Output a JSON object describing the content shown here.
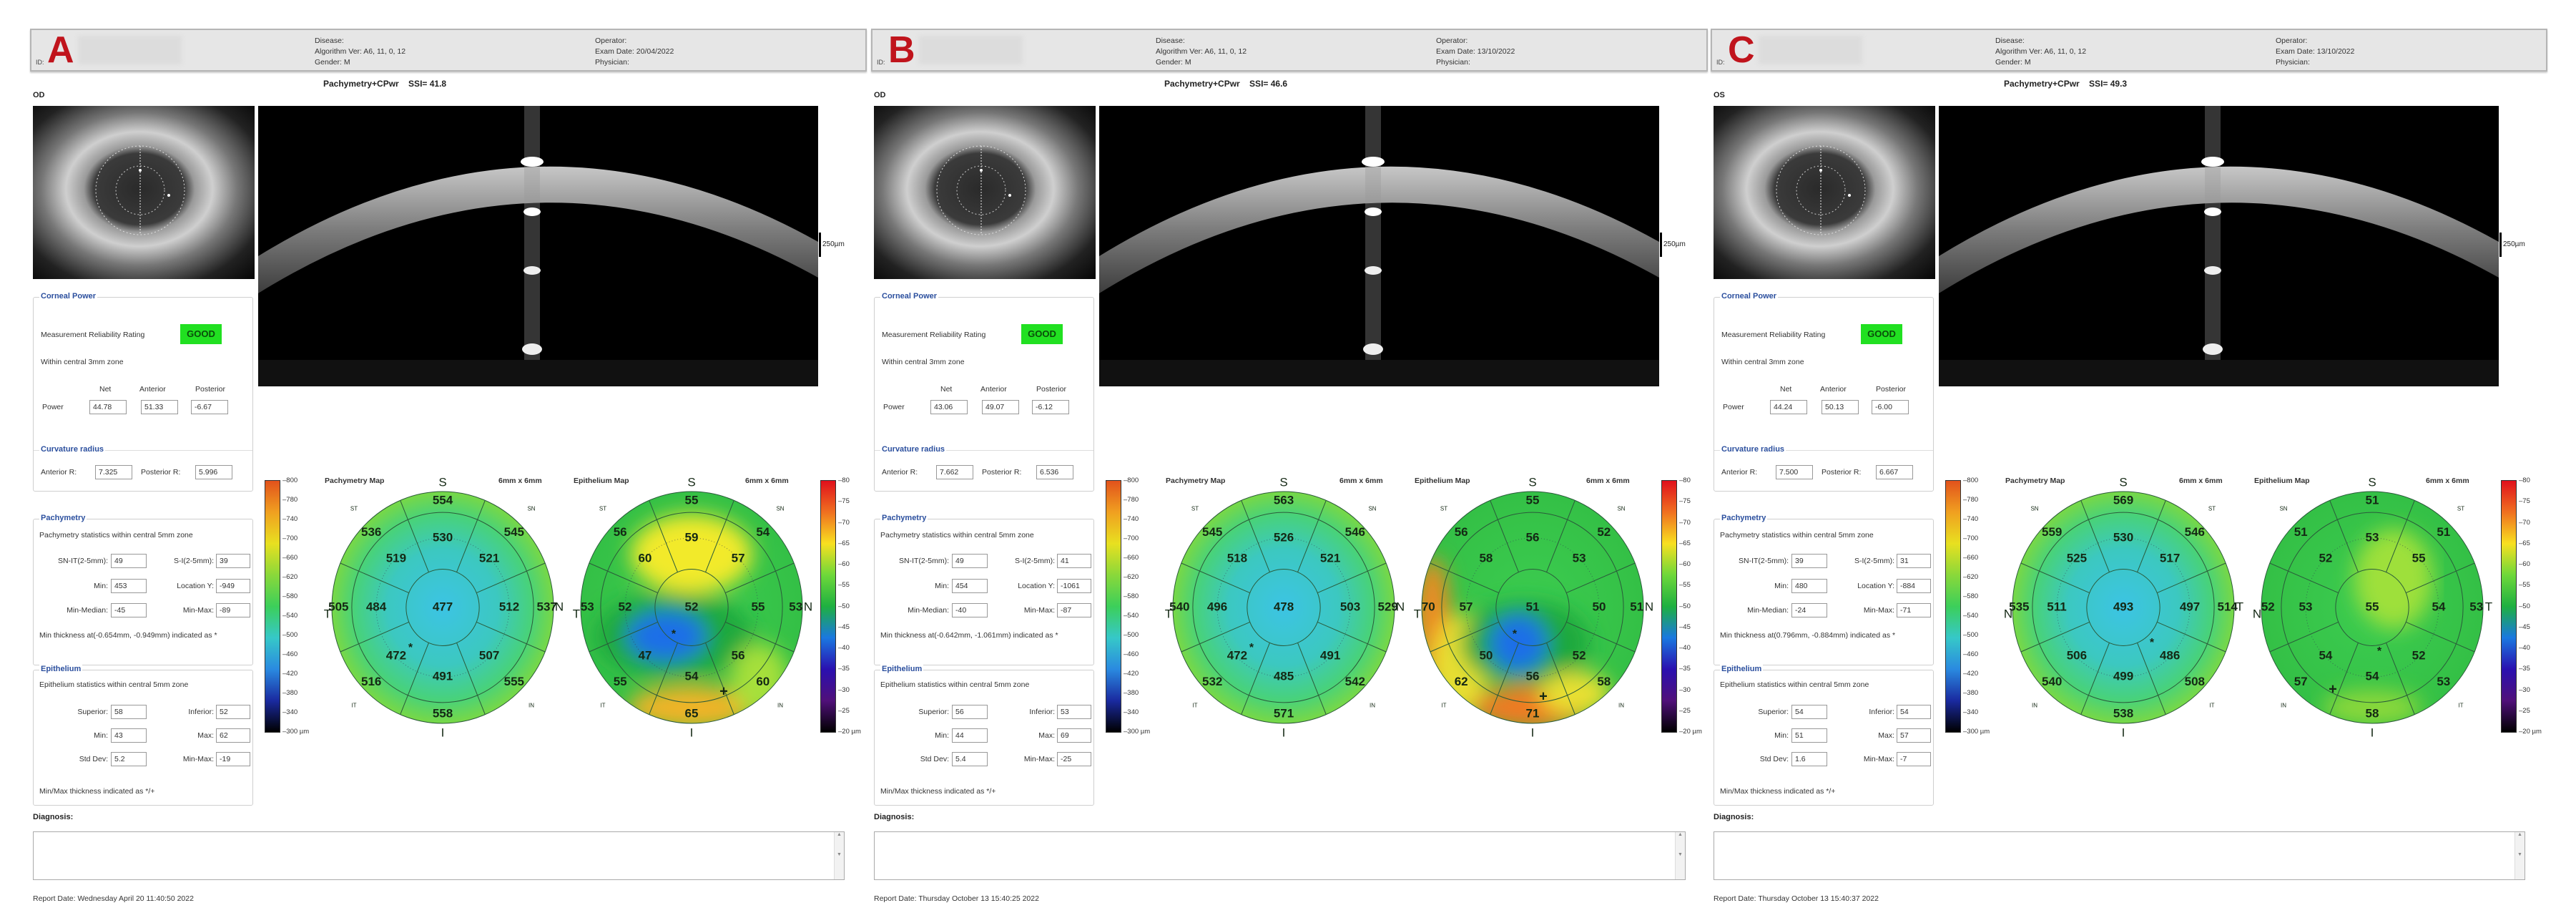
{
  "panels": [
    {
      "letter": "A",
      "id_label": "ID:",
      "header": {
        "disease": "Disease:",
        "algorithm": "Algorithm Ver: A6, 11, 0, 12",
        "gender": "Gender: M",
        "operator": "Operator:",
        "exam_date": "Exam Date: 20/04/2022",
        "physician": "Physician:"
      },
      "scan_title": "Pachymetry+CPwr    SSI= 41.8",
      "eye": "OD",
      "scale_label": "250µm",
      "corneal_power": {
        "heading": "Corneal Power",
        "rating_label": "Measurement Reliability Rating",
        "rating": "GOOD",
        "zone": "Within central 3mm zone",
        "col_net": "Net",
        "col_anterior": "Anterior",
        "col_posterior": "Posterior",
        "row_label": "Power",
        "net": "44.78",
        "anterior": "51.33",
        "posterior": "-6.67"
      },
      "curvature": {
        "heading": "Curvature radius",
        "anterior_label": "Anterior R:",
        "anterior": "7.325",
        "posterior_label": "Posterior R:",
        "posterior": "5.996"
      },
      "pachymetry": {
        "heading": "Pachymetry",
        "subtitle": "Pachymetry statistics within central 5mm zone",
        "snit_label": "SN-IT(2-5mm):",
        "snit": "49",
        "si_label": "S-I(2-5mm):",
        "si": "39",
        "min_label": "Min:",
        "min": "453",
        "locy_label": "Location Y:",
        "locy": "-949",
        "minmed_label": "Min-Median:",
        "minmed": "-45",
        "minmax_label": "Min-Max:",
        "minmax": "-89",
        "note": "Min thickness at(-0.654mm, -0.949mm) indicated as *"
      },
      "epithelium": {
        "heading": "Epithelium",
        "subtitle": "Epithelium statistics within central 5mm zone",
        "sup_label": "Superior:",
        "sup": "58",
        "inf_label": "Inferior:",
        "inf": "52",
        "min_label": "Min:",
        "min": "43",
        "max_label": "Max:",
        "max": "62",
        "sd_label": "Std Dev:",
        "sd": "5.2",
        "minmax_label": "Min-Max:",
        "minmax": "-19",
        "note": "Min/Max thickness indicated as */+"
      },
      "orientation": {
        "top": "S",
        "bottom": "I",
        "left": "T",
        "right": "N",
        "top_left": "ST",
        "top_right": "SN",
        "bottom_left": "IT",
        "bottom_right": "IN"
      },
      "pachy_map": {
        "title": "Pachymetry Map",
        "size": "6mm x 6mm",
        "center": "477",
        "inner": {
          "top": "530",
          "top_left": "519",
          "top_right": "521",
          "left": "484",
          "right": "512",
          "bottom_left": "472",
          "bottom_right": "507",
          "bottom": "491"
        },
        "outer": {
          "top": "554",
          "top_left": "536",
          "top_right": "545",
          "left": "505",
          "right": "537",
          "bottom_left": "516",
          "bottom_right": "555",
          "bottom": "558"
        }
      },
      "epi_map": {
        "title": "Epithelium Map",
        "size": "6mm x 6mm",
        "center": "52",
        "inner": {
          "top": "59",
          "top_left": "60",
          "top_right": "57",
          "left": "52",
          "right": "55",
          "bottom_left": "47",
          "bottom_right": "56",
          "bottom": "54"
        },
        "outer": {
          "top": "55",
          "top_left": "56",
          "top_right": "54",
          "left": "53",
          "right": "53",
          "bottom_left": "55",
          "bottom_right": "60",
          "bottom": "65"
        }
      },
      "diagnosis_label": "Diagnosis:",
      "report_date": "Report Date: Wednesday April 20 11:40:50 2022"
    },
    {
      "letter": "B",
      "id_label": "ID:",
      "header": {
        "disease": "Disease:",
        "algorithm": "Algorithm Ver: A6, 11, 0, 12",
        "gender": "Gender: M",
        "operator": "Operator:",
        "exam_date": "Exam Date: 13/10/2022",
        "physician": "Physician:"
      },
      "scan_title": "Pachymetry+CPwr    SSI= 46.6",
      "eye": "OD",
      "scale_label": "250µm",
      "corneal_power": {
        "heading": "Corneal Power",
        "rating_label": "Measurement Reliability Rating",
        "rating": "GOOD",
        "zone": "Within central 3mm zone",
        "col_net": "Net",
        "col_anterior": "Anterior",
        "col_posterior": "Posterior",
        "row_label": "Power",
        "net": "43.06",
        "anterior": "49.07",
        "posterior": "-6.12"
      },
      "curvature": {
        "heading": "Curvature radius",
        "anterior_label": "Anterior R:",
        "anterior": "7.662",
        "posterior_label": "Posterior R:",
        "posterior": "6.536"
      },
      "pachymetry": {
        "heading": "Pachymetry",
        "subtitle": "Pachymetry statistics within central 5mm zone",
        "snit_label": "SN-IT(2-5mm):",
        "snit": "49",
        "si_label": "S-I(2-5mm):",
        "si": "41",
        "min_label": "Min:",
        "min": "454",
        "locy_label": "Location Y:",
        "locy": "-1061",
        "minmed_label": "Min-Median:",
        "minmed": "-40",
        "minmax_label": "Min-Max:",
        "minmax": "-87",
        "note": "Min thickness at(-0.642mm, -1.061mm) indicated as *"
      },
      "epithelium": {
        "heading": "Epithelium",
        "subtitle": "Epithelium statistics within central 5mm zone",
        "sup_label": "Superior:",
        "sup": "56",
        "inf_label": "Inferior:",
        "inf": "53",
        "min_label": "Min:",
        "min": "44",
        "max_label": "Max:",
        "max": "69",
        "sd_label": "Std Dev:",
        "sd": "5.4",
        "minmax_label": "Min-Max:",
        "minmax": "-25",
        "note": "Min/Max thickness indicated as */+"
      },
      "orientation": {
        "top": "S",
        "bottom": "I",
        "left": "T",
        "right": "N",
        "top_left": "ST",
        "top_right": "SN",
        "bottom_left": "IT",
        "bottom_right": "IN"
      },
      "pachy_map": {
        "title": "Pachymetry Map",
        "size": "6mm x 6mm",
        "center": "478",
        "inner": {
          "top": "526",
          "top_left": "518",
          "top_right": "521",
          "left": "496",
          "right": "503",
          "bottom_left": "472",
          "bottom_right": "491",
          "bottom": "485"
        },
        "outer": {
          "top": "563",
          "top_left": "545",
          "top_right": "546",
          "left": "540",
          "right": "529",
          "bottom_left": "532",
          "bottom_right": "542",
          "bottom": "571"
        }
      },
      "epi_map": {
        "title": "Epithelium Map",
        "size": "6mm x 6mm",
        "center": "51",
        "inner": {
          "top": "56",
          "top_left": "58",
          "top_right": "53",
          "left": "57",
          "right": "50",
          "bottom_left": "50",
          "bottom_right": "52",
          "bottom": "56"
        },
        "outer": {
          "top": "55",
          "top_left": "56",
          "top_right": "52",
          "left": "70",
          "right": "51",
          "bottom_left": "62",
          "bottom_right": "58",
          "bottom": "71"
        }
      },
      "diagnosis_label": "Diagnosis:",
      "report_date": "Report Date: Thursday October 13 15:40:25 2022"
    },
    {
      "letter": "C",
      "id_label": "ID:",
      "header": {
        "disease": "Disease:",
        "algorithm": "Algorithm Ver: A6, 11, 0, 12",
        "gender": "Gender: M",
        "operator": "Operator:",
        "exam_date": "Exam Date: 13/10/2022",
        "physician": "Physician:"
      },
      "scan_title": "Pachymetry+CPwr    SSI= 49.3",
      "eye": "OS",
      "scale_label": "250µm",
      "corneal_power": {
        "heading": "Corneal Power",
        "rating_label": "Measurement Reliability Rating",
        "rating": "GOOD",
        "zone": "Within central 3mm zone",
        "col_net": "Net",
        "col_anterior": "Anterior",
        "col_posterior": "Posterior",
        "row_label": "Power",
        "net": "44.24",
        "anterior": "50.13",
        "posterior": "-6.00"
      },
      "curvature": {
        "heading": "Curvature radius",
        "anterior_label": "Anterior R:",
        "anterior": "7.500",
        "posterior_label": "Posterior R:",
        "posterior": "6.667"
      },
      "pachymetry": {
        "heading": "Pachymetry",
        "subtitle": "Pachymetry statistics within central 5mm zone",
        "snit_label": "SN-IT(2-5mm):",
        "snit": "39",
        "si_label": "S-I(2-5mm):",
        "si": "31",
        "min_label": "Min:",
        "min": "480",
        "locy_label": "Location Y:",
        "locy": "-884",
        "minmed_label": "Min-Median:",
        "minmed": "-24",
        "minmax_label": "Min-Max:",
        "minmax": "-71",
        "note": "Min thickness at(0.796mm, -0.884mm) indicated as *"
      },
      "epithelium": {
        "heading": "Epithelium",
        "subtitle": "Epithelium statistics within central 5mm zone",
        "sup_label": "Superior:",
        "sup": "54",
        "inf_label": "Inferior:",
        "inf": "54",
        "min_label": "Min:",
        "min": "51",
        "max_label": "Max:",
        "max": "57",
        "sd_label": "Std Dev:",
        "sd": "1.6",
        "minmax_label": "Min-Max:",
        "minmax": "-7",
        "note": "Min/Max thickness indicated as */+"
      },
      "orientation": {
        "top": "S",
        "bottom": "I",
        "left": "N",
        "right": "T",
        "top_left": "SN",
        "top_right": "ST",
        "bottom_left": "IN",
        "bottom_right": "IT"
      },
      "pachy_map": {
        "title": "Pachymetry Map",
        "size": "6mm x 6mm",
        "center": "493",
        "inner": {
          "top": "530",
          "top_left": "525",
          "top_right": "517",
          "left": "511",
          "right": "497",
          "bottom_left": "506",
          "bottom_right": "486",
          "bottom": "499"
        },
        "outer": {
          "top": "569",
          "top_left": "559",
          "top_right": "546",
          "left": "535",
          "right": "514",
          "bottom_left": "540",
          "bottom_right": "508",
          "bottom": "538"
        }
      },
      "epi_map": {
        "title": "Epithelium Map",
        "size": "6mm x 6mm",
        "center": "55",
        "inner": {
          "top": "53",
          "top_left": "52",
          "top_right": "55",
          "left": "53",
          "right": "54",
          "bottom_left": "54",
          "bottom_right": "52",
          "bottom": "54"
        },
        "outer": {
          "top": "51",
          "top_left": "51",
          "top_right": "51",
          "left": "52",
          "right": "53",
          "bottom_left": "57",
          "bottom_right": "53",
          "bottom": "58"
        }
      },
      "diagnosis_label": "Diagnosis:",
      "report_date": "Report Date: Thursday October 13 15:40:37 2022"
    }
  ],
  "pachy_scale": {
    "ticks": [
      "800",
      "780",
      "740",
      "700",
      "660",
      "620",
      "580",
      "540",
      "500",
      "460",
      "420",
      "380",
      "340",
      "300 µm"
    ],
    "colors": [
      "#e2521c",
      "#f0a020",
      "#e8e020",
      "#8ad83a",
      "#3ccf5a",
      "#36c8c8",
      "#2a8ae0",
      "#1a2aa0",
      "#000000"
    ]
  },
  "epi_scale": {
    "ticks": [
      "80",
      "75",
      "70",
      "65",
      "60",
      "55",
      "50",
      "45",
      "40",
      "35",
      "30",
      "25",
      "20 µm"
    ],
    "colors": [
      "#e0101c",
      "#f07020",
      "#f8e020",
      "#6ed83a",
      "#1eb040",
      "#1a78e0",
      "#2a10b0",
      "#50107a",
      "#000000"
    ]
  },
  "colors": {
    "rating_good": "#21e021",
    "section_heading": "#2b4f9e",
    "panel_letter": "#c0141c"
  }
}
